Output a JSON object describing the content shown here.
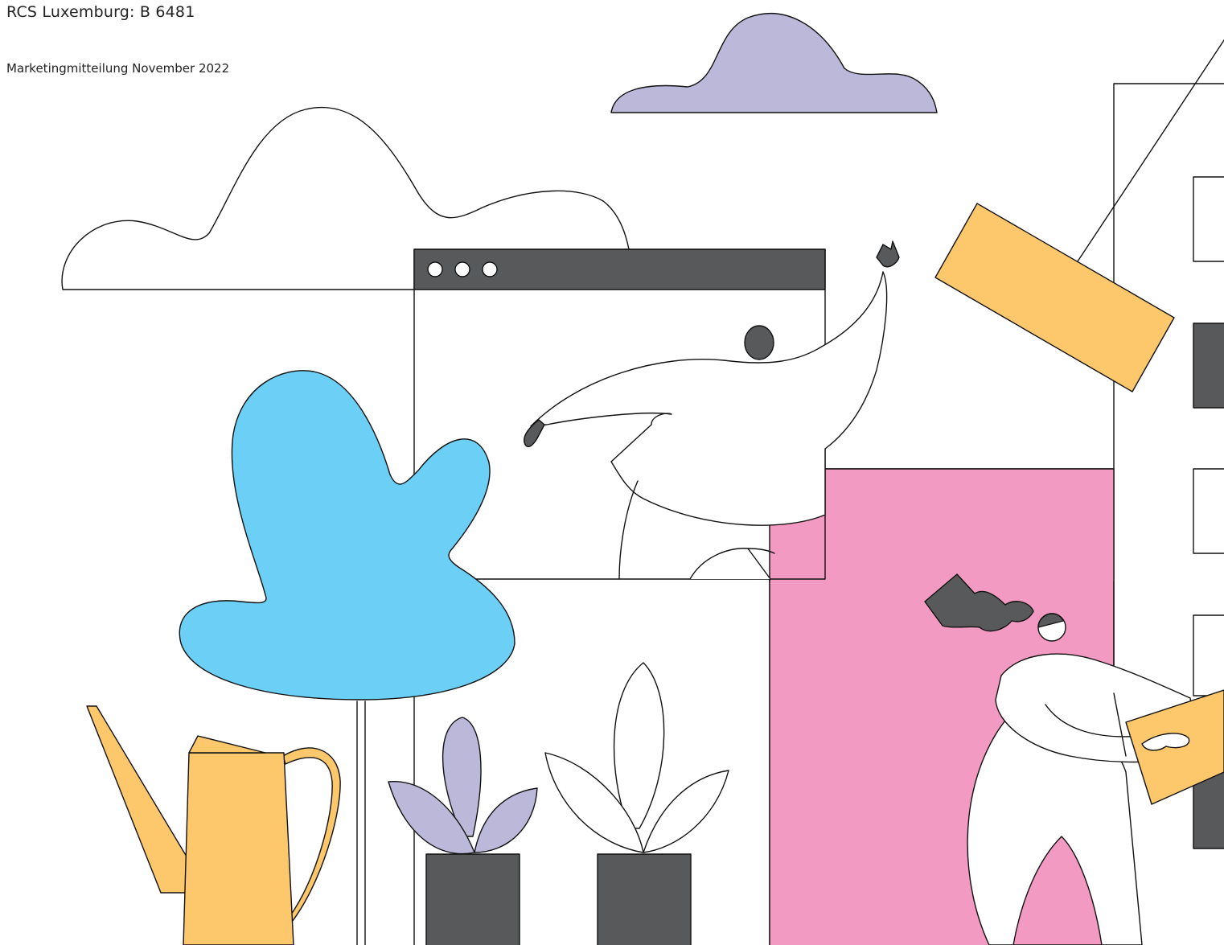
{
  "header": {
    "registry_label": "RCS Luxemburg: B 6481",
    "communication_label": "Marketingmitteilung November 2022"
  },
  "palette": {
    "lavender": "#BCB8DA",
    "sky_blue": "#6CCFF6",
    "yellow": "#FDC86C",
    "pink": "#F39AC2",
    "charcoal": "#58595B",
    "stroke": "#111111",
    "background": "#FFFFFF"
  }
}
